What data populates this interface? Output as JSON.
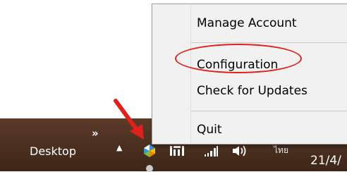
{
  "taskbar": {
    "desktop_label": "Desktop",
    "chevrons": "»",
    "show_hidden_arrow": "▲",
    "language_label": "ไทย",
    "date_text": "21/4/"
  },
  "context_menu": {
    "items": [
      {
        "label": "Manage Account"
      },
      {
        "label": "Configuration"
      },
      {
        "label": "Check for Updates"
      },
      {
        "label": "Quit"
      }
    ]
  },
  "annotation": {
    "color": "#e0201a",
    "highlighted_item": "Configuration"
  },
  "icons": {
    "app_tray_icon": "app-tray-icon",
    "network": "network-icon",
    "signal": "signal-icon",
    "volume": "volume-icon"
  },
  "colors": {
    "taskbar": "#4a2f1f",
    "menu_background": "#f1f1f1",
    "annotation": "#e0201a"
  }
}
